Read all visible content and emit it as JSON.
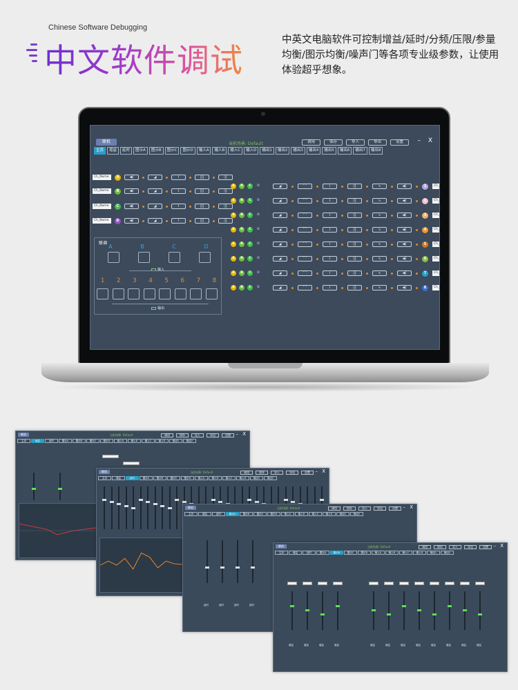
{
  "header": {
    "en_title": "Chinese Software Debugging",
    "cn_title": "中文软件调试",
    "description": "中英文电脑软件可控制增益/延时/分频/压限/参量均衡/图示均衡/噪声门等各项专业级参数，让使用体验超乎想象。"
  },
  "app": {
    "link_button": "联机",
    "scene": "当前场景: Default",
    "buttons": [
      "调用",
      "保存",
      "导入",
      "导出",
      "设置"
    ],
    "window_controls": "– X",
    "tabs": [
      "主页",
      "增益",
      "延时",
      "图示A",
      "图示B",
      "图示C",
      "图示D",
      "输入A",
      "输入B",
      "输入C",
      "输入D",
      "输出1",
      "输出2",
      "输出3",
      "输出4",
      "输出5",
      "输出6",
      "输出7",
      "输出8"
    ],
    "active_tab": 0,
    "inputs": [
      {
        "name": "Ch_Name",
        "label": "A",
        "color": "#e6b800"
      },
      {
        "name": "Ch_Name",
        "label": "B",
        "color": "#6fbf3a"
      },
      {
        "name": "Ch_Name",
        "label": "C",
        "color": "#3fbf4a"
      },
      {
        "name": "Ch_Name",
        "label": "D",
        "color": "#9b4fd0"
      }
    ],
    "input_modules": [
      "◀)",
      "◢",
      "⌇",
      "|||",
      "▯|"
    ],
    "matrix_labels": [
      "A",
      "B",
      "C",
      "D"
    ],
    "matrix_colors": [
      "#e6b800",
      "#6fbf3a",
      "#3fbf4a",
      "#9b4fd0"
    ],
    "output_modules": [
      "◢",
      "⌒",
      "⌇",
      "▯|",
      "∿",
      "◀)"
    ],
    "outputs": [
      {
        "num": "1",
        "name": "Ch_Name",
        "color": "#b9a6e0"
      },
      {
        "num": "2",
        "name": "Ch_Name",
        "color": "#f0c0d8"
      },
      {
        "num": "3",
        "name": "Ch_Name",
        "color": "#f0b070"
      },
      {
        "num": "4",
        "name": "Ch_Name",
        "color": "#e89a2e"
      },
      {
        "num": "5",
        "name": "Ch_Name",
        "color": "#d07a20"
      },
      {
        "num": "6",
        "name": "Ch_Name",
        "color": "#8fbf3a"
      },
      {
        "num": "7",
        "name": "Ch_Name",
        "color": "#2aa0c8"
      },
      {
        "num": "8",
        "name": "Ch_Name",
        "color": "#3a6fd0"
      }
    ],
    "link_panel": {
      "title": "联调",
      "letters": [
        "A",
        "B",
        "C",
        "D"
      ],
      "input_label": "输入",
      "numbers": [
        "1",
        "2",
        "3",
        "4",
        "5",
        "6",
        "7",
        "8"
      ],
      "output_label": "输出"
    }
  },
  "windows": {
    "link": "联机",
    "scene": "当前场景: Default",
    "buttons": [
      "调用",
      "保存",
      "导入",
      "导出",
      "设置"
    ],
    "tabs": [
      "主页",
      "增益",
      "延时",
      "图示A",
      "图示B",
      "图示C",
      "图示D",
      "输入A",
      "输入B",
      "输入C",
      "输入D",
      "输出1",
      "输出2"
    ],
    "gain_label": "增益",
    "delay_label": "延时",
    "mute_label": "静音"
  }
}
